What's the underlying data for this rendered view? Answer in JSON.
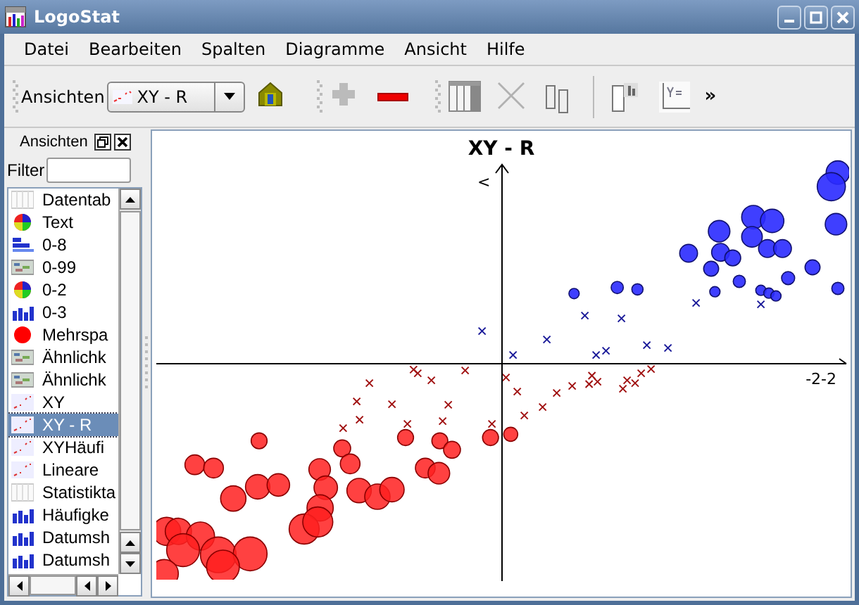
{
  "window": {
    "title": "LogoStat"
  },
  "menu": [
    "Datei",
    "Bearbeiten",
    "Spalten",
    "Diagramme",
    "Ansicht",
    "Hilfe"
  ],
  "toolbar": {
    "views_label": "Ansichten",
    "views_dropdown": {
      "value": "XY - R"
    },
    "buttons": [
      {
        "kind": "home",
        "disabled": false
      },
      {
        "kind": "add",
        "disabled": true
      },
      {
        "kind": "remove",
        "disabled": false
      },
      {
        "kind": "columns",
        "disabled": false
      },
      {
        "kind": "delete",
        "disabled": true
      },
      {
        "kind": "split",
        "disabled": false
      },
      {
        "kind": "chart",
        "disabled": false
      },
      {
        "kind": "formula",
        "disabled": false
      }
    ],
    "overflow": "»"
  },
  "sidebar": {
    "title": "Ansichten",
    "filter_label": "Filter",
    "items": [
      {
        "label": "Datentab",
        "kind": "table",
        "selected": false
      },
      {
        "label": "Text",
        "kind": "pie",
        "selected": false
      },
      {
        "label": "0-8",
        "kind": "hbar",
        "selected": false
      },
      {
        "label": "0-99",
        "kind": "grid",
        "selected": false
      },
      {
        "label": "0-2",
        "kind": "pie",
        "selected": false
      },
      {
        "label": "0-3",
        "kind": "bar",
        "selected": false
      },
      {
        "label": "Mehrspa",
        "kind": "dot",
        "selected": false
      },
      {
        "label": "Ähnlichk",
        "kind": "grid",
        "selected": false
      },
      {
        "label": "Ähnlichk",
        "kind": "grid",
        "selected": false
      },
      {
        "label": "XY",
        "kind": "scatter",
        "selected": false
      },
      {
        "label": "XY - R",
        "kind": "scatter",
        "selected": true
      },
      {
        "label": "XYHäufi",
        "kind": "scatter",
        "selected": false
      },
      {
        "label": "Lineare",
        "kind": "scatter",
        "selected": false
      },
      {
        "label": "Statistikta",
        "kind": "table",
        "selected": false
      },
      {
        "label": "Häufigke",
        "kind": "bar",
        "selected": false
      },
      {
        "label": "Datumsh",
        "kind": "bar",
        "selected": false
      },
      {
        "label": "Datumsh",
        "kind": "bar",
        "selected": false
      }
    ]
  },
  "chart": {
    "title": "XY - R",
    "x_axis_label": "-2-2",
    "y_axis_label": "<"
  }
}
